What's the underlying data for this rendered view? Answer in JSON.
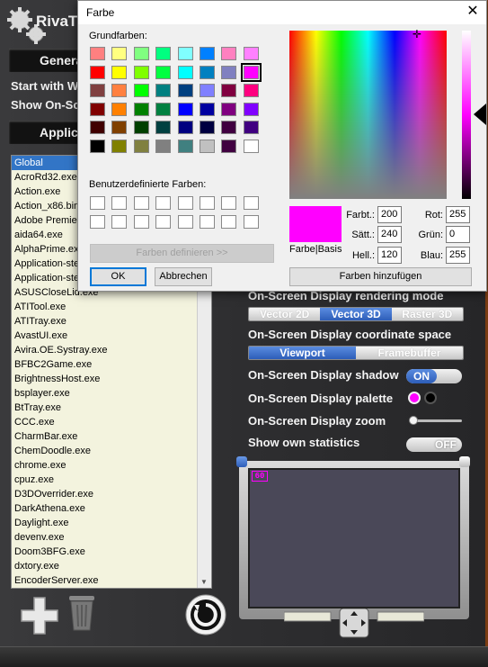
{
  "rivatuner": {
    "app_title": "RivaTu",
    "tabs": {
      "general": "Genera",
      "applications": "Applica"
    },
    "menu": {
      "start_with": "Start with W",
      "show_osd": "Show On-Sc"
    },
    "app_list": [
      "Global",
      "AcroRd32.exe",
      "Action.exe",
      "Action_x86.bin",
      "Adobe Premiere",
      "aida64.exe",
      "AlphaPrime.exe",
      "Application-stea",
      "Application-stea",
      "ASUSCloseLid.exe",
      "ATITool.exe",
      "ATITray.exe",
      "AvastUI.exe",
      "Avira.OE.Systray.exe",
      "BFBC2Game.exe",
      "BrightnessHost.exe",
      "bsplayer.exe",
      "BtTray.exe",
      "CCC.exe",
      "CharmBar.exe",
      "ChemDoodle.exe",
      "chrome.exe",
      "cpuz.exe",
      "D3DOverrider.exe",
      "DarkAthena.exe",
      "Daylight.exe",
      "devenv.exe",
      "Doom3BFG.exe",
      "dxtory.exe",
      "EncoderServer.exe"
    ],
    "settings": {
      "render_mode_label": "On-Screen Display rendering mode",
      "render_mode_options": [
        "Vector 2D",
        "Vector 3D",
        "Raster 3D"
      ],
      "render_mode_selected": "Vector 3D",
      "coord_space_label": "On-Screen Display coordinate space",
      "coord_space_options": [
        "Viewport",
        "Framebuffer"
      ],
      "coord_space_selected": "Viewport",
      "shadow_label": "On-Screen Display shadow",
      "shadow_value": "ON",
      "palette_label": "On-Screen Display palette",
      "palette_colors": [
        "#ff00ff",
        "#000000"
      ],
      "zoom_label": "On-Screen Display zoom",
      "zoom_level": 0.05,
      "stats_label": "Show own statistics",
      "stats_value": "OFF"
    },
    "preview": {
      "osd_text": "60"
    }
  },
  "dialog": {
    "title": "Farbe",
    "close_glyph": "✕",
    "basic_colors_label": "Grundfarben:",
    "basic_colors": [
      "#ff8080",
      "#ffff80",
      "#80ff80",
      "#00ff80",
      "#80ffff",
      "#0080ff",
      "#ff80c0",
      "#ff80ff",
      "#ff0000",
      "#ffff00",
      "#80ff00",
      "#00ff40",
      "#00ffff",
      "#0080c0",
      "#8080c0",
      "#ff00ff",
      "#804040",
      "#ff8040",
      "#00ff00",
      "#008080",
      "#004080",
      "#8080ff",
      "#800040",
      "#ff0080",
      "#800000",
      "#ff8000",
      "#008000",
      "#008040",
      "#0000ff",
      "#0000a0",
      "#800080",
      "#8000ff",
      "#400000",
      "#804000",
      "#004000",
      "#004040",
      "#000080",
      "#000040",
      "#400040",
      "#400080",
      "#000000",
      "#808000",
      "#808040",
      "#808080",
      "#408080",
      "#c0c0c0",
      "#400040",
      "#ffffff"
    ],
    "selected_basic_index": 15,
    "custom_colors_label": "Benutzerdefinierte Farben:",
    "define_button": "Farben definieren >>",
    "ok_button": "OK",
    "cancel_button": "Abbrechen",
    "color_solid_label": "Farbe|Basis",
    "hue_label": "Farbt.:",
    "hue_value": "200",
    "sat_label": "Sätt.:",
    "sat_value": "240",
    "lum_label": "Hell.:",
    "lum_value": "120",
    "red_label": "Rot:",
    "red_value": "255",
    "green_label": "Grün:",
    "green_value": "0",
    "blue_label": "Blau:",
    "blue_value": "255",
    "add_button": "Farben hinzufügen",
    "current_color": "#ff00ff"
  }
}
